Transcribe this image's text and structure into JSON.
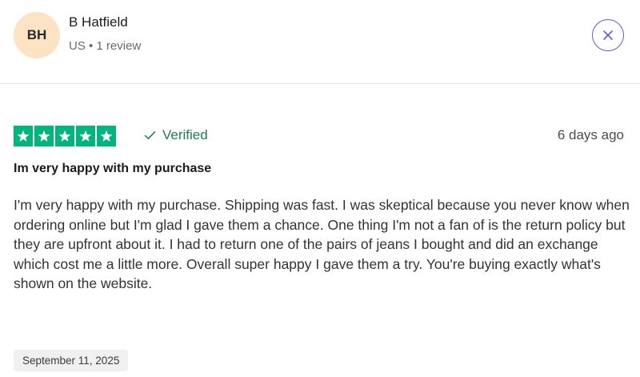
{
  "reviewer": {
    "initials": "BH",
    "name": "B Hatfield",
    "meta": "US • 1 review"
  },
  "close_icon": "close-icon",
  "rating": {
    "stars": 5,
    "max": 5,
    "star_color": "#00b67a"
  },
  "verified": {
    "icon": "check-icon",
    "label": "Verified"
  },
  "review": {
    "relative_date": "6 days ago",
    "title": "Im very happy with my purchase",
    "body": "I'm very happy with my purchase. Shipping was fast. I was skeptical because you never know when ordering online but I'm glad I gave them a chance. One thing I'm not a fan of is the return policy but they are upfront about it. I had to return one of the pairs of jeans I bought and did an exchange which cost me a little more. Overall super happy I gave them a try. You're buying exactly what's shown on the website.",
    "experience_date": "September 11, 2025"
  }
}
